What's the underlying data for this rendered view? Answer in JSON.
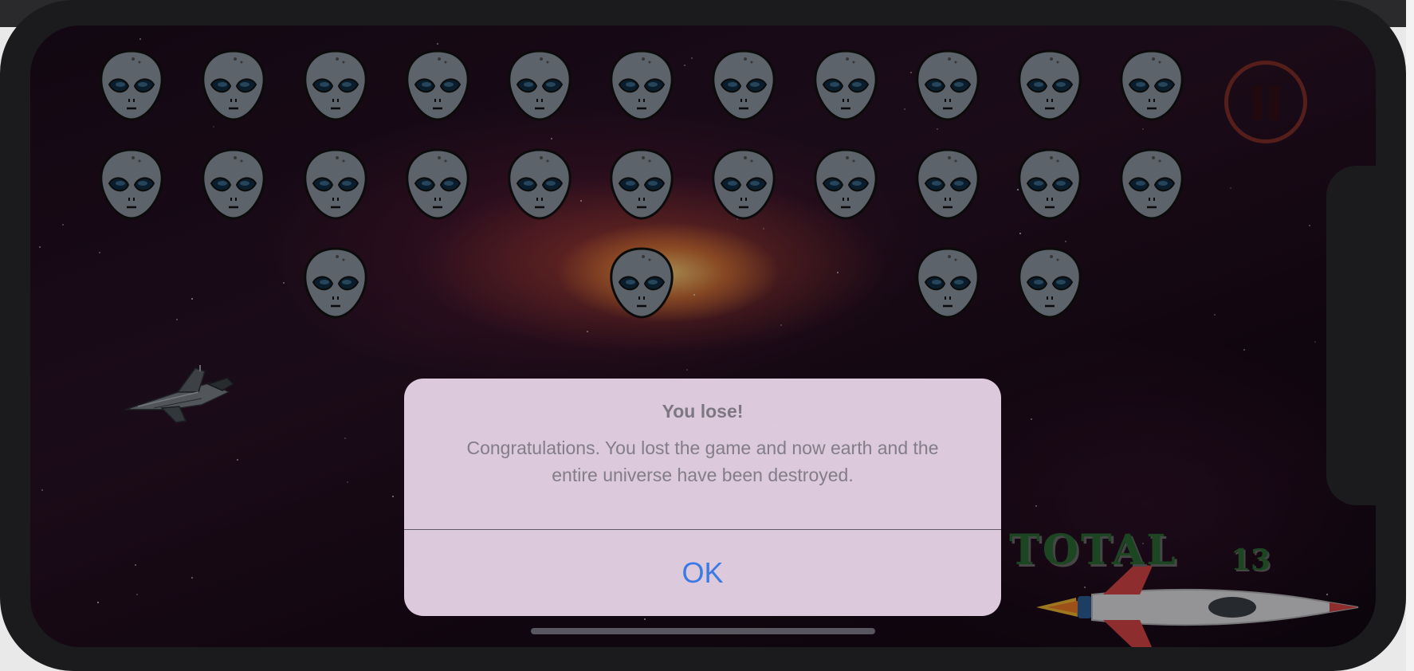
{
  "game": {
    "aliens": [
      [
        1,
        1,
        1,
        1,
        1,
        1,
        1,
        1,
        1,
        1,
        1
      ],
      [
        1,
        1,
        1,
        1,
        1,
        1,
        1,
        1,
        1,
        1,
        1
      ],
      [
        0,
        0,
        1,
        0,
        0,
        1,
        0,
        0,
        1,
        1,
        0
      ]
    ],
    "score_label": "TOTAL",
    "score_value": "13",
    "pause_icon": "pause-icon"
  },
  "alert": {
    "title": "You lose!",
    "message_line1": "Congratulations. You lost the game and now earth and the",
    "message_line2": "entire universe have been destroyed.",
    "ok_label": "OK"
  },
  "colors": {
    "alert_ok": "#3a7ae2",
    "score": "#2c6b35",
    "pause_ring": "#a23a2c",
    "alien_head": "#8f98a4",
    "alien_eye": "#0f2d44"
  }
}
